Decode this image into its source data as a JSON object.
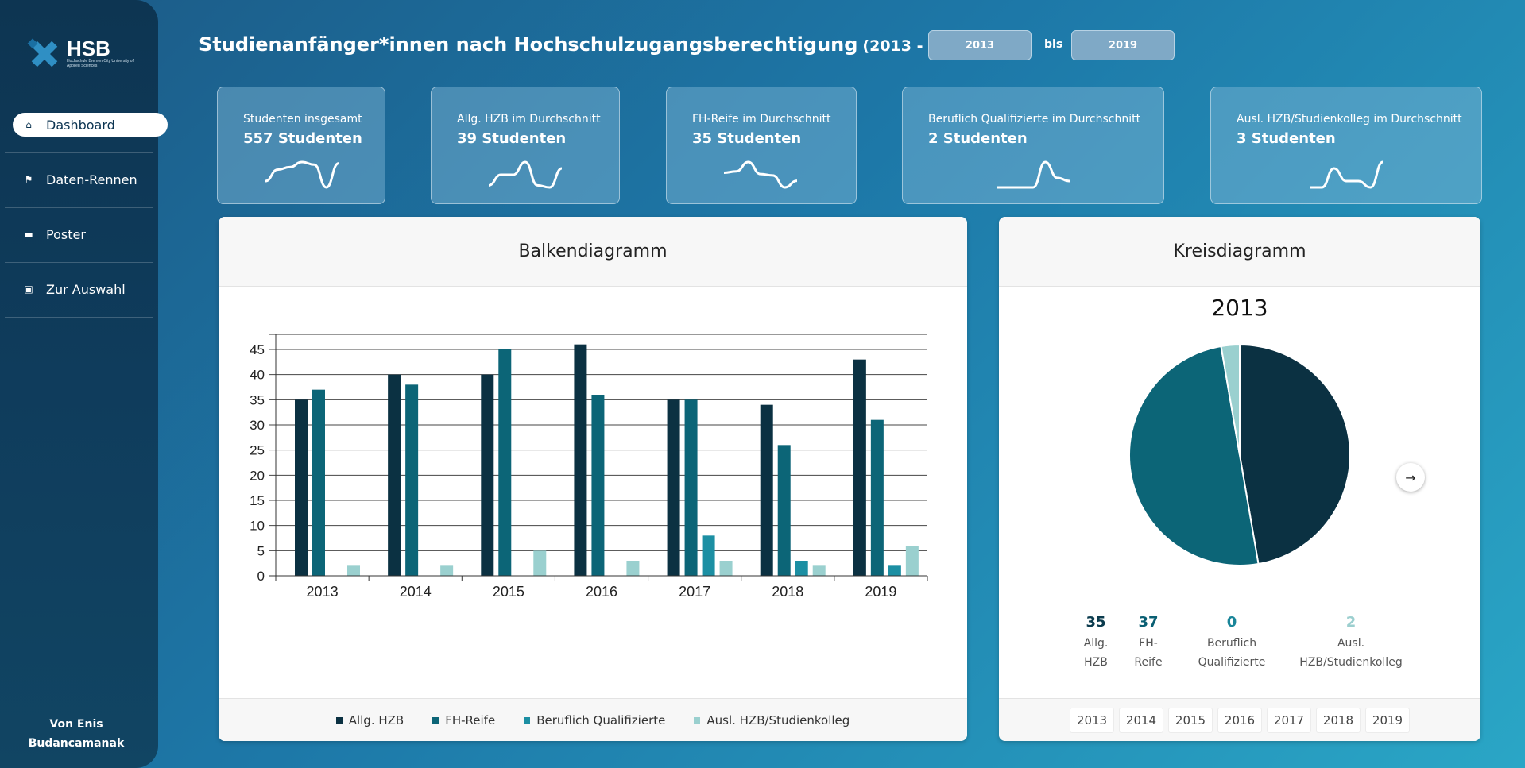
{
  "sidebar": {
    "logo_text": "HSB",
    "logo_sub": "Hochschule Bremen City University of Applied Sciences",
    "items": [
      {
        "label": "Dashboard",
        "icon": "home-icon"
      },
      {
        "label": "Daten-Rennen",
        "icon": "flag-icon"
      },
      {
        "label": "Poster",
        "icon": "clapperboard-icon"
      },
      {
        "label": "Zur Auswahl",
        "icon": "chart-icon"
      }
    ],
    "author_line1": "Von Enis",
    "author_line2": "Budancamanak"
  },
  "header": {
    "title": "Studienanfänger*innen nach Hochschulzugangsberechtigung",
    "range": "(2013 - 2019)",
    "from_year": "2013",
    "to_year": "2019",
    "bis": "bis"
  },
  "kpis": [
    {
      "label": "Studenten insgesamt",
      "value": "557 Studenten",
      "trend": [
        103,
        112,
        114,
        118,
        116,
        98,
        117
      ]
    },
    {
      "label": "Allg. HZB im Durchschnitt",
      "value": "39 Studenten",
      "trend": [
        35,
        40,
        40,
        46,
        35,
        34,
        43
      ]
    },
    {
      "label": "FH-Reife im Durchschnitt",
      "value": "35 Studenten",
      "trend": [
        37,
        38,
        45,
        36,
        35,
        26,
        31
      ]
    },
    {
      "label": "Beruflich Qualifizierte im Durchschnitt",
      "value": "2 Studenten",
      "trend": [
        0,
        0,
        0,
        0,
        8,
        3,
        2
      ]
    },
    {
      "label": "Ausl. HZB/Studienkolleg im Durchschnitt",
      "value": "3 Studenten",
      "trend": [
        2,
        2,
        5,
        3,
        3,
        2,
        6
      ]
    }
  ],
  "bar_panel": {
    "title": "Balkendiagramm"
  },
  "pie_panel": {
    "title": "Kreisdiagramm",
    "year": "2013",
    "stats": [
      {
        "value": "35",
        "label1": "Allg.",
        "label2": "HZB",
        "color": "#0b3c4e"
      },
      {
        "value": "37",
        "label1": "FH-",
        "label2": "Reife",
        "color": "#0a5f73"
      },
      {
        "value": "0",
        "label1": "Beruflich",
        "label2": "Qualifizierte",
        "color": "#1a8599"
      },
      {
        "value": "2",
        "label1": "Ausl.",
        "label2": "HZB/Studienkolleg",
        "color": "#9ccfcf"
      }
    ],
    "year_chips": [
      "2013",
      "2014",
      "2015",
      "2016",
      "2017",
      "2018",
      "2019"
    ]
  },
  "chart_data": [
    {
      "type": "bar",
      "title": "Balkendiagramm",
      "categories": [
        "2013",
        "2014",
        "2015",
        "2016",
        "2017",
        "2018",
        "2019"
      ],
      "ylim": [
        0,
        48
      ],
      "yticks": [
        0,
        5,
        10,
        15,
        20,
        25,
        30,
        35,
        40,
        45
      ],
      "grid": true,
      "legend": "bottom",
      "series": [
        {
          "name": "Allg. HZB",
          "color": "#0b3142",
          "values": [
            35,
            40,
            40,
            46,
            35,
            34,
            43
          ]
        },
        {
          "name": "FH-Reife",
          "color": "#0c6577",
          "values": [
            37,
            38,
            45,
            36,
            35,
            26,
            31
          ]
        },
        {
          "name": "Beruflich Qualifizierte",
          "color": "#1c8fa3",
          "values": [
            0,
            0,
            0,
            0,
            8,
            3,
            2
          ]
        },
        {
          "name": "Ausl. HZB/Studienkolleg",
          "color": "#9ad0cf",
          "values": [
            2,
            2,
            5,
            3,
            3,
            2,
            6
          ]
        }
      ]
    },
    {
      "type": "pie",
      "title": "2013",
      "labels": [
        "Allg. HZB",
        "FH-Reife",
        "Beruflich Qualifizierte",
        "Ausl. HZB/Studienkolleg"
      ],
      "values": [
        35,
        37,
        0,
        2
      ],
      "colors": [
        "#0b3142",
        "#0c6577",
        "#1c8fa3",
        "#9ad0cf"
      ]
    }
  ]
}
